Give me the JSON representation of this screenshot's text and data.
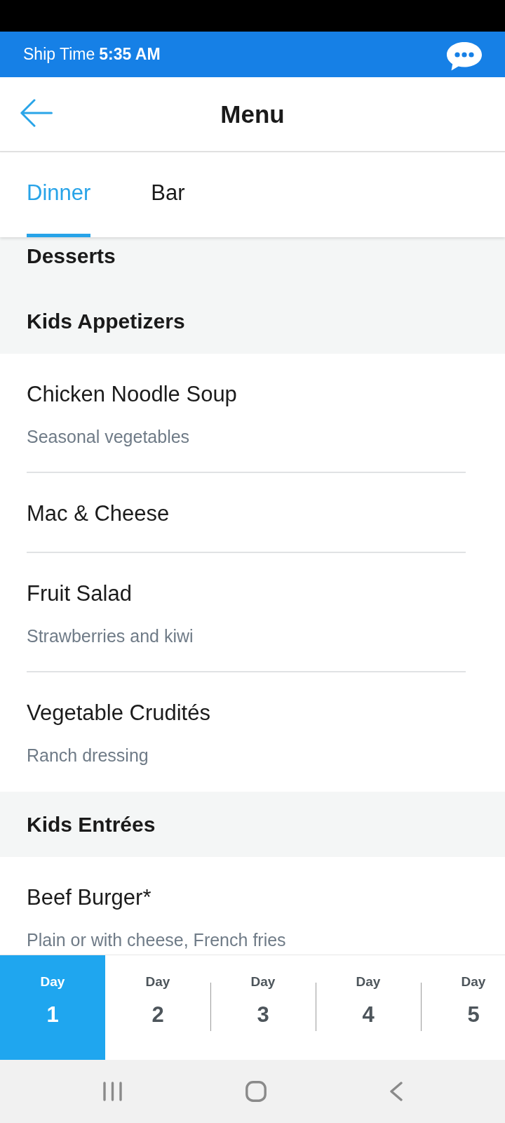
{
  "top_bar": {
    "label": "Ship Time",
    "time": "5:35 AM"
  },
  "header": {
    "title": "Menu"
  },
  "tabs": [
    {
      "label": "Dinner",
      "selected": true
    },
    {
      "label": "Bar",
      "selected": false
    }
  ],
  "menu_rows": [
    {
      "kind": "section",
      "title": "Desserts"
    },
    {
      "kind": "section",
      "title": "Kids Appetizers"
    },
    {
      "kind": "item",
      "name": "Chicken Noodle Soup",
      "description": "Seasonal vegetables"
    },
    {
      "kind": "item",
      "name": "Mac & Cheese"
    },
    {
      "kind": "item",
      "name": "Fruit Salad",
      "description": "Strawberries and kiwi"
    },
    {
      "kind": "item",
      "name": "Vegetable Crudités",
      "description": "Ranch dressing"
    },
    {
      "kind": "section",
      "title": "Kids Entrées"
    },
    {
      "kind": "item",
      "name": "Beef Burger*",
      "description": "Plain or with cheese, French fries"
    }
  ],
  "days": [
    {
      "label": "Day",
      "number": "1",
      "selected": true
    },
    {
      "label": "Day",
      "number": "2",
      "selected": false
    },
    {
      "label": "Day",
      "number": "3",
      "selected": false
    },
    {
      "label": "Day",
      "number": "4",
      "selected": false
    },
    {
      "label": "Day",
      "number": "5",
      "selected": false
    }
  ]
}
